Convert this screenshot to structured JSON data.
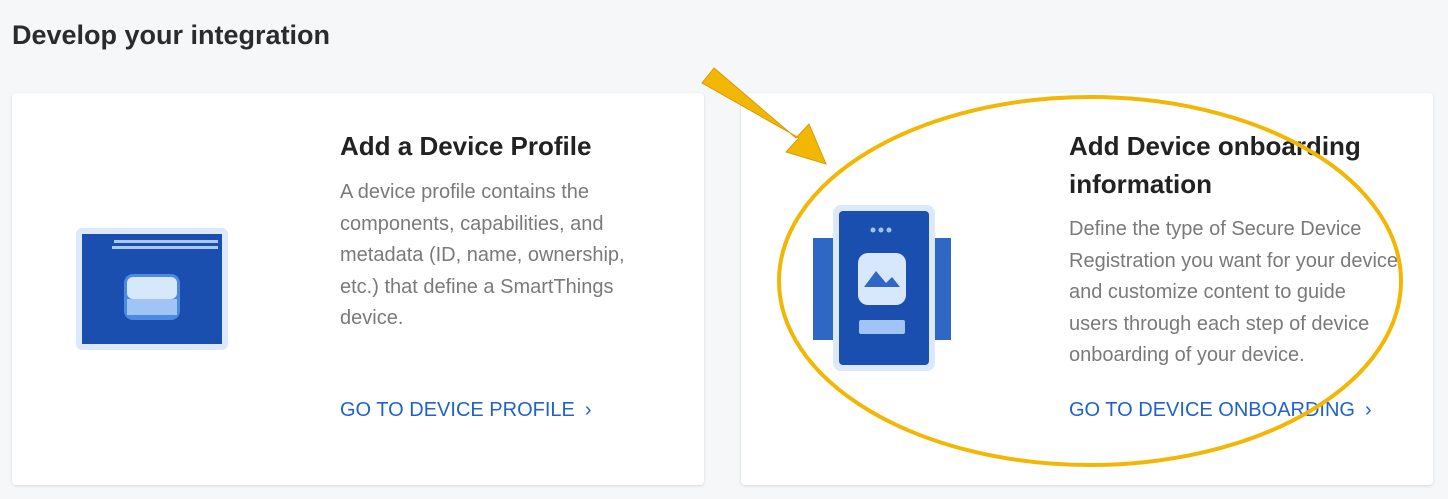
{
  "section": {
    "title": "Develop your integration"
  },
  "cards": [
    {
      "title": "Add a Device Profile",
      "description": "A device profile contains the components, capabilities, and metadata (ID, name, ownership, etc.) that define a SmartThings device.",
      "link_label": "GO TO DEVICE PROFILE",
      "illustration": "device-profile-illustration"
    },
    {
      "title": "Add Device onboarding information",
      "description": "Define the type of Secure Device Registration you want for your device and customize content to guide users through each step of device onboarding of your device.",
      "link_label": "GO TO DEVICE ONBOARDING",
      "illustration": "phone-onboarding-illustration"
    }
  ],
  "icons": {
    "link_chevron": "chevron-right-icon"
  },
  "colors": {
    "accent": "#1f63c9",
    "illustration_blue": "#1a4fb0",
    "annotation": "#f2b705",
    "page_bg": "#f6f7f9"
  }
}
